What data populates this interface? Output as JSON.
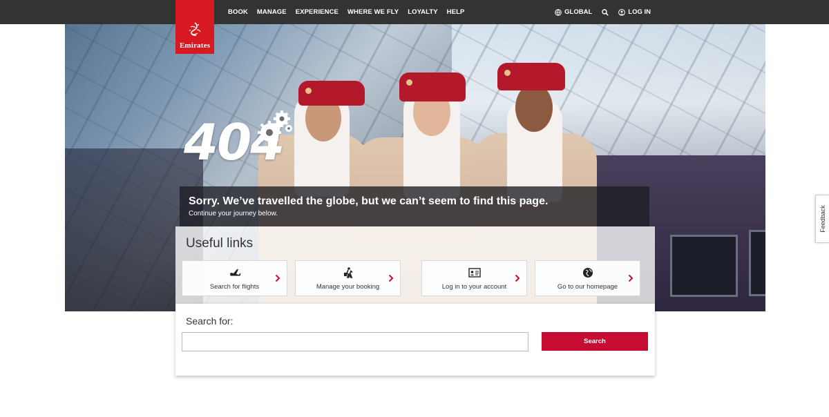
{
  "brand": {
    "logo_text": "Emirates",
    "primary_color": "#d71921"
  },
  "nav": {
    "items": [
      {
        "label": "BOOK"
      },
      {
        "label": "MANAGE"
      },
      {
        "label": "EXPERIENCE"
      },
      {
        "label": "WHERE WE FLY"
      },
      {
        "label": "LOYALTY"
      },
      {
        "label": "HELP"
      }
    ],
    "region_label": "GLOBAL",
    "login_label": "LOG IN"
  },
  "error": {
    "code": "404",
    "title": "Sorry. We’ve travelled the globe, but we can’t seem to find this page.",
    "subtitle": "Continue your journey below."
  },
  "useful_links": {
    "heading": "Useful links",
    "items": [
      {
        "label": "Search for flights",
        "icon": "plane-icon"
      },
      {
        "label": "Manage your booking",
        "icon": "traveller-luggage-icon"
      },
      {
        "label": "Log in to your account",
        "icon": "id-card-icon"
      },
      {
        "label": "Go to our homepage",
        "icon": "globe-icon"
      }
    ]
  },
  "search": {
    "label": "Search for:",
    "value": "",
    "button_label": "Search",
    "button_color": "#c60c30"
  },
  "feedback": {
    "label": "Feedback"
  }
}
